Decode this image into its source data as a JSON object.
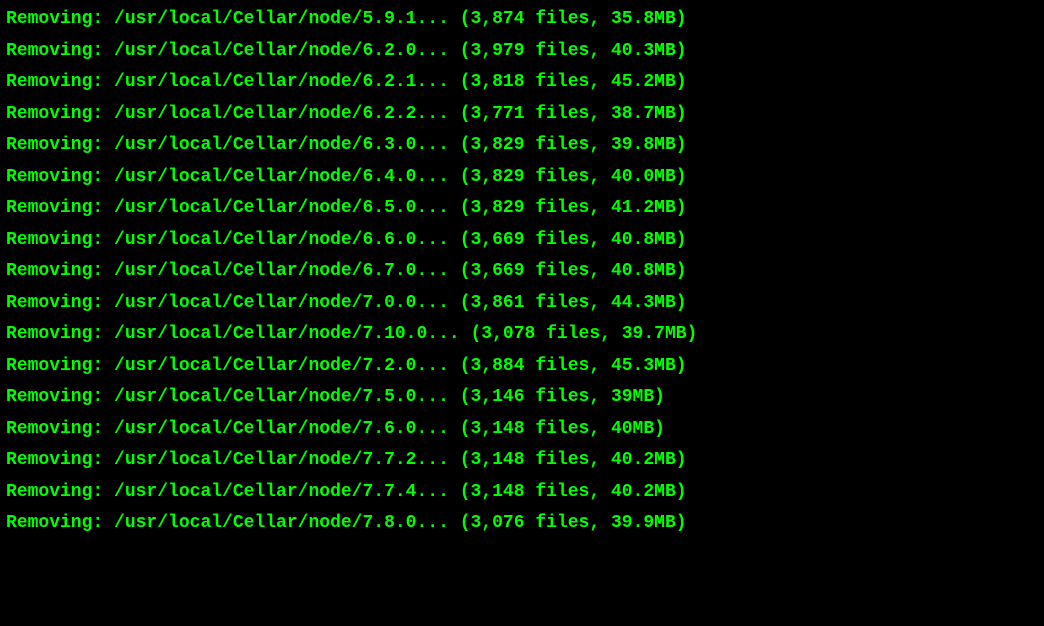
{
  "terminal": {
    "lines": [
      {
        "action": "Removing:",
        "path": "/usr/local/Cellar/node/5.9.1...",
        "files": "3,874",
        "size": "35.8MB"
      },
      {
        "action": "Removing:",
        "path": "/usr/local/Cellar/node/6.2.0...",
        "files": "3,979",
        "size": "40.3MB"
      },
      {
        "action": "Removing:",
        "path": "/usr/local/Cellar/node/6.2.1...",
        "files": "3,818",
        "size": "45.2MB"
      },
      {
        "action": "Removing:",
        "path": "/usr/local/Cellar/node/6.2.2...",
        "files": "3,771",
        "size": "38.7MB"
      },
      {
        "action": "Removing:",
        "path": "/usr/local/Cellar/node/6.3.0...",
        "files": "3,829",
        "size": "39.8MB"
      },
      {
        "action": "Removing:",
        "path": "/usr/local/Cellar/node/6.4.0...",
        "files": "3,829",
        "size": "40.0MB"
      },
      {
        "action": "Removing:",
        "path": "/usr/local/Cellar/node/6.5.0...",
        "files": "3,829",
        "size": "41.2MB"
      },
      {
        "action": "Removing:",
        "path": "/usr/local/Cellar/node/6.6.0...",
        "files": "3,669",
        "size": "40.8MB"
      },
      {
        "action": "Removing:",
        "path": "/usr/local/Cellar/node/6.7.0...",
        "files": "3,669",
        "size": "40.8MB"
      },
      {
        "action": "Removing:",
        "path": "/usr/local/Cellar/node/7.0.0...",
        "files": "3,861",
        "size": "44.3MB"
      },
      {
        "action": "Removing:",
        "path": "/usr/local/Cellar/node/7.10.0...",
        "files": "3,078",
        "size": "39.7MB"
      },
      {
        "action": "Removing:",
        "path": "/usr/local/Cellar/node/7.2.0...",
        "files": "3,884",
        "size": "45.3MB"
      },
      {
        "action": "Removing:",
        "path": "/usr/local/Cellar/node/7.5.0...",
        "files": "3,146",
        "size": "39MB"
      },
      {
        "action": "Removing:",
        "path": "/usr/local/Cellar/node/7.6.0...",
        "files": "3,148",
        "size": "40MB"
      },
      {
        "action": "Removing:",
        "path": "/usr/local/Cellar/node/7.7.2...",
        "files": "3,148",
        "size": "40.2MB"
      },
      {
        "action": "Removing:",
        "path": "/usr/local/Cellar/node/7.7.4...",
        "files": "3,148",
        "size": "40.2MB"
      },
      {
        "action": "Removing:",
        "path": "/usr/local/Cellar/node/7.8.0...",
        "files": "3,076",
        "size": "39.9MB"
      }
    ]
  }
}
